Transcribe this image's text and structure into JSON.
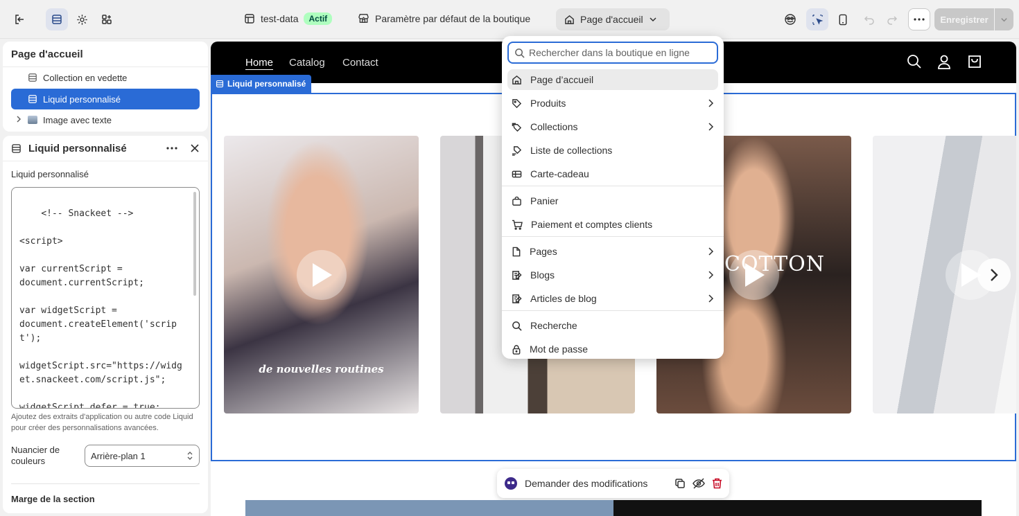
{
  "topbar": {
    "store_name": "test-data",
    "status_badge": "Actif",
    "theme_setting": "Paramètre par défaut de la boutique",
    "current_page": "Page d'accueil",
    "save_label": "Enregistrer"
  },
  "sidebar": {
    "title": "Page d'accueil",
    "sections": [
      {
        "label": "Collection en vedette"
      },
      {
        "label": "Liquid personnalisé"
      },
      {
        "label": "Image avec texte"
      }
    ]
  },
  "settings": {
    "title": "Liquid personnalisé",
    "field_label": "Liquid personnalisé",
    "code": "<!-- Snackeet -->\n\n<script>\n\nvar currentScript =\ndocument.currentScript;\n\nvar widgetScript =\ndocument.createElement('script');\n\nwidgetScript.src=\"https://widget.snackeet.com/script.js\";\n\nwidgetScript.defer = true;",
    "help": "Ajoutez des extraits d'application ou autre code Liquid pour créer des personnalisations avancées.",
    "swatch_label": "Nuancier de couleurs",
    "swatch_value": "Arrière-plan 1",
    "margin_label": "Marge de la section"
  },
  "preview": {
    "nav": [
      "Home",
      "Catalog",
      "Contact"
    ],
    "section_tag": "Liquid personnalisé",
    "video1_caption": "de nouvelles routines",
    "video3_text": "COTTON",
    "ask_label": "Demander des modifications"
  },
  "dropdown": {
    "search_placeholder": "Rechercher dans la boutique en ligne",
    "items": [
      {
        "label": "Page d’accueil",
        "icon": "home-icon"
      },
      {
        "label": "Produits",
        "icon": "tag-icon"
      },
      {
        "label": "Collections",
        "icon": "collection-icon"
      },
      {
        "label": "Liste de collections",
        "icon": "collection-list-icon"
      },
      {
        "label": "Carte-cadeau",
        "icon": "gift-card-icon"
      },
      {
        "label": "Panier",
        "icon": "bag-icon"
      },
      {
        "label": "Paiement et comptes clients",
        "icon": "cart-icon"
      },
      {
        "label": "Pages",
        "icon": "page-icon"
      },
      {
        "label": "Blogs",
        "icon": "blog-icon"
      },
      {
        "label": "Articles de blog",
        "icon": "blog-post-icon"
      },
      {
        "label": "Recherche",
        "icon": "search-icon"
      },
      {
        "label": "Mot de passe",
        "icon": "lock-icon"
      }
    ]
  },
  "colors": {
    "accent": "#2a6bd6",
    "badge_bg": "#affebf",
    "delete": "#c70a24"
  }
}
